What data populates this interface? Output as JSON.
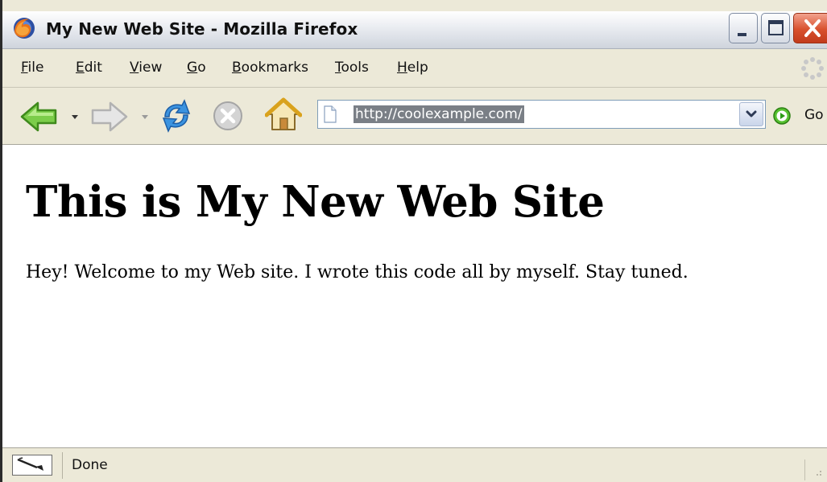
{
  "window": {
    "title": "My New Web Site - Mozilla Firefox"
  },
  "menubar": {
    "items": [
      {
        "mnemonic": "F",
        "rest": "ile"
      },
      {
        "mnemonic": "E",
        "rest": "dit"
      },
      {
        "mnemonic": "V",
        "rest": "iew"
      },
      {
        "mnemonic": "G",
        "rest": "o"
      },
      {
        "mnemonic": "B",
        "rest": "ookmarks"
      },
      {
        "mnemonic": "T",
        "rest": "ools"
      },
      {
        "mnemonic": "H",
        "rest": "elp"
      }
    ]
  },
  "navbar": {
    "url": "http://coolexample.com/",
    "go_label": "Go"
  },
  "page": {
    "heading": "This is My New Web Site",
    "paragraph": "Hey! Welcome to my Web site. I wrote this code all by myself. Stay tuned."
  },
  "statusbar": {
    "text": "Done"
  },
  "colors": {
    "nav_green": "#5cb82c",
    "reload_blue": "#2f86d6",
    "close_red": "#d8502d",
    "chrome_bg": "#ece9d8"
  }
}
